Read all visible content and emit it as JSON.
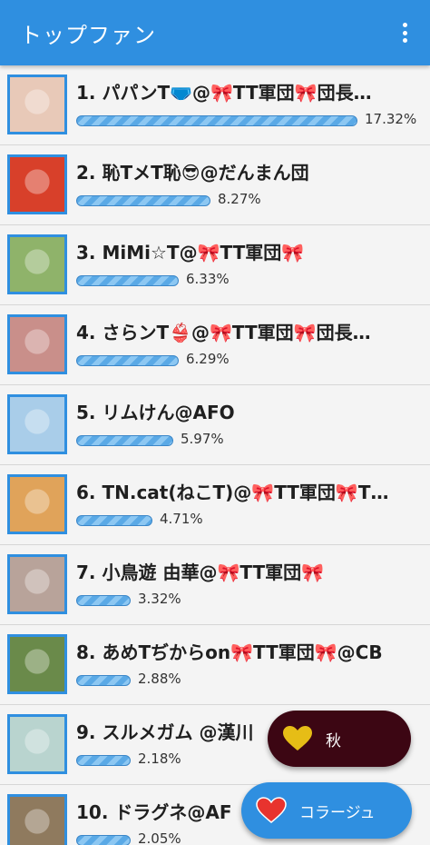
{
  "header": {
    "title": "トップファン"
  },
  "fans": [
    {
      "rank_name": "1. パパンT🩲@🎀TT軍団🎀団長…",
      "percent_text": "17.32%",
      "share": 0.1732,
      "avatar_color": "#e8c9b8"
    },
    {
      "rank_name": "2. 恥TメT恥😎@だんまん団",
      "percent_text": "8.27%",
      "share": 0.0827,
      "avatar_color": "#d8402a"
    },
    {
      "rank_name": "3. MiMi☆T@🎀TT軍団🎀",
      "percent_text": "6.33%",
      "share": 0.0633,
      "avatar_color": "#8fb36a"
    },
    {
      "rank_name": "4. さらンT👙@🎀TT軍団🎀団長…",
      "percent_text": "6.29%",
      "share": 0.0629,
      "avatar_color": "#c98f8a"
    },
    {
      "rank_name": "5. リムけん@AFO",
      "percent_text": "5.97%",
      "share": 0.0597,
      "avatar_color": "#a9cde9"
    },
    {
      "rank_name": "6. TN.cat(ねこT)@🎀TT軍団🎀T…",
      "percent_text": "4.71%",
      "share": 0.0471,
      "avatar_color": "#e0a35a"
    },
    {
      "rank_name": "7. 小鳥遊 由華@🎀TT軍団🎀",
      "percent_text": "3.32%",
      "share": 0.0332,
      "avatar_color": "#b8a39a"
    },
    {
      "rank_name": "8. あめTぢからon🎀TT軍団🎀@CB",
      "percent_text": "2.88%",
      "share": 0.0288,
      "avatar_color": "#6a8a4a"
    },
    {
      "rank_name": "9. スルメガム @漢川",
      "percent_text": "2.18%",
      "share": 0.0218,
      "avatar_color": "#b9d4cf"
    },
    {
      "rank_name": "10. ドラグネ@AF",
      "percent_text": "2.05%",
      "share": 0.0205,
      "avatar_color": "#8f7a5e"
    }
  ],
  "fab_autumn": {
    "label": "秋",
    "icon": "heart-yellow-icon",
    "color": "#3c0613",
    "icon_color": "#e6bd16"
  },
  "fab_collage": {
    "label": "コラージュ",
    "icon": "heart-red-icon",
    "color": "#2f8fe0",
    "icon_color": "#e8332e"
  },
  "colors": {
    "accent": "#2f8fe0"
  }
}
